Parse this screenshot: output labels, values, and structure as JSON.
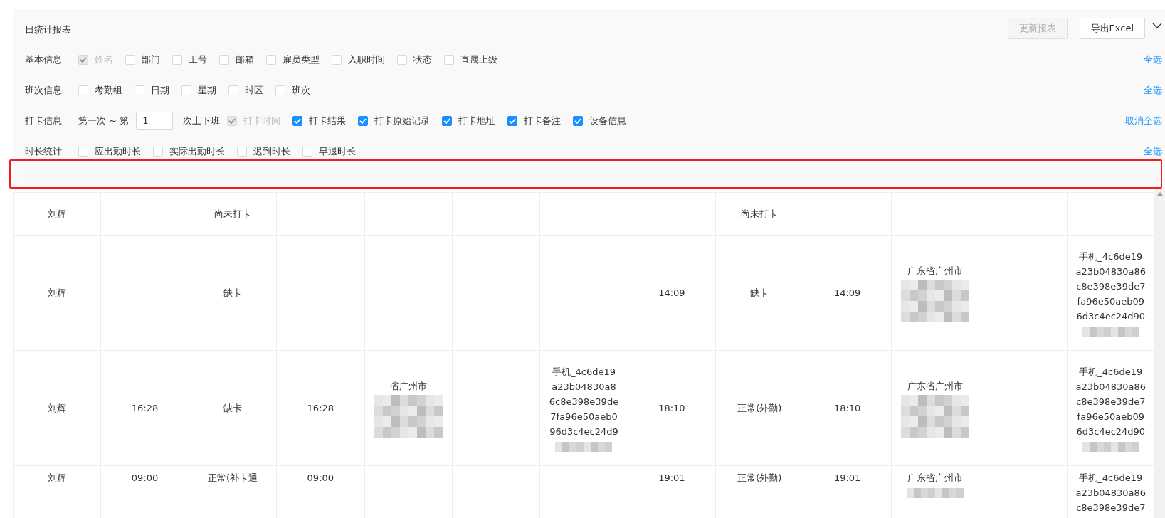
{
  "report": {
    "title": "日统计报表",
    "buttons": [
      {
        "label": "更新报表",
        "disabled": true
      },
      {
        "label": "导出Excel",
        "disabled": false
      }
    ]
  },
  "filter_groups": [
    {
      "label": "基本信息",
      "toggle_link": "全选",
      "items": [
        {
          "label": "姓名",
          "checked": true,
          "disabled": true
        },
        {
          "label": "部门",
          "checked": false,
          "disabled": false
        },
        {
          "label": "工号",
          "checked": false,
          "disabled": false
        },
        {
          "label": "邮箱",
          "checked": false,
          "disabled": false
        },
        {
          "label": "雇员类型",
          "checked": false,
          "disabled": false
        },
        {
          "label": "入职时间",
          "checked": false,
          "disabled": false
        },
        {
          "label": "状态",
          "checked": false,
          "disabled": false
        },
        {
          "label": "直属上级",
          "checked": false,
          "disabled": false
        }
      ]
    },
    {
      "label": "班次信息",
      "toggle_link": "全选",
      "items": [
        {
          "label": "考勤组",
          "checked": false,
          "disabled": false
        },
        {
          "label": "日期",
          "checked": false,
          "disabled": false
        },
        {
          "label": "星期",
          "checked": false,
          "disabled": false
        },
        {
          "label": "时区",
          "checked": false,
          "disabled": false
        },
        {
          "label": "班次",
          "checked": false,
          "disabled": false
        }
      ]
    },
    {
      "label": "打卡信息",
      "toggle_link": "取消全选",
      "range": {
        "prefix": "第一次 ~ 第",
        "value": "1",
        "suffix": "次上下班"
      },
      "items": [
        {
          "label": "打卡时间",
          "checked": true,
          "disabled": true
        },
        {
          "label": "打卡结果",
          "checked": true,
          "disabled": false
        },
        {
          "label": "打卡原始记录",
          "checked": true,
          "disabled": false
        },
        {
          "label": "打卡地址",
          "checked": true,
          "disabled": false
        },
        {
          "label": "打卡备注",
          "checked": true,
          "disabled": false
        },
        {
          "label": "设备信息",
          "checked": true,
          "disabled": false
        }
      ]
    },
    {
      "label": "时长统计",
      "toggle_link": "全选",
      "items": [
        {
          "label": "应出勤时长",
          "checked": false,
          "disabled": false
        },
        {
          "label": "实际出勤时长",
          "checked": false,
          "disabled": false
        },
        {
          "label": "迟到时长",
          "checked": false,
          "disabled": false
        },
        {
          "label": "早退时长",
          "checked": false,
          "disabled": false
        }
      ]
    }
  ],
  "table": {
    "rows": [
      {
        "cells": [
          {
            "lines": [
              "刘辉"
            ]
          },
          {},
          {
            "lines": [
              "尚未打卡"
            ]
          },
          {},
          {},
          {},
          {},
          {},
          {
            "lines": [
              "尚未打卡"
            ]
          },
          {},
          {},
          {},
          {}
        ]
      },
      {
        "cells": [
          {
            "lines": [
              "刘辉"
            ]
          },
          {},
          {
            "lines": [
              "缺卡"
            ]
          },
          {},
          {},
          {},
          {},
          {
            "lines": [
              "14:09"
            ]
          },
          {
            "lines": [
              "缺卡"
            ]
          },
          {
            "lines": [
              "14:09"
            ]
          },
          {
            "lines": [
              "广东省广州市"
            ],
            "redacted": true
          },
          {},
          {
            "lines": [
              "手机_4c6de19",
              "a23b04830a86",
              "c8e398e39de7",
              "fa96e50aeb09",
              "6d3c4ec24d90"
            ],
            "redacted": true
          }
        ]
      },
      {
        "cells": [
          {
            "lines": [
              "刘辉"
            ]
          },
          {
            "lines": [
              "16:28"
            ]
          },
          {
            "lines": [
              "缺卡"
            ]
          },
          {
            "lines": [
              "16:28"
            ]
          },
          {
            "lines": [
              "省广州市"
            ],
            "redacted": true
          },
          {},
          {
            "lines": [
              "手机_4c6de19",
              "a23b04830a8",
              "6c8e398e39de",
              "7fa96e50aeb0",
              "96d3c4ec24d9"
            ],
            "redacted": true
          },
          {
            "lines": [
              "18:10"
            ]
          },
          {
            "lines": [
              "正常(外勤)"
            ]
          },
          {
            "lines": [
              "18:10"
            ]
          },
          {
            "lines": [
              "广东省广州市"
            ],
            "redacted": true
          },
          {},
          {
            "lines": [
              "手机_4c6de19",
              "a23b04830a86",
              "c8e398e39de7",
              "fa96e50aeb09",
              "6d3c4ec24d90"
            ],
            "redacted": true
          }
        ]
      },
      {
        "cells": [
          {
            "lines": [
              "刘辉"
            ]
          },
          {
            "lines": [
              "09:00"
            ]
          },
          {
            "lines": [
              "正常(补卡通"
            ]
          },
          {
            "lines": [
              "09:00"
            ]
          },
          {},
          {},
          {},
          {
            "lines": [
              "19:01"
            ]
          },
          {
            "lines": [
              "正常(外勤)"
            ]
          },
          {
            "lines": [
              "19:01"
            ]
          },
          {
            "lines": [
              "广东省广州市"
            ],
            "redacted": true
          },
          {},
          {
            "lines": [
              "手机_4c6de19",
              "a23b04830a86",
              "c8e398e39de7"
            ]
          }
        ]
      }
    ]
  }
}
